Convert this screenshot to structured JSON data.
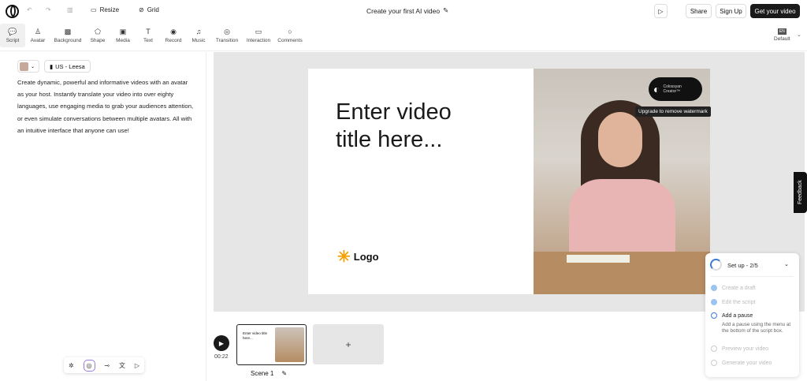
{
  "header": {
    "title": "Create your first AI video",
    "resize": "Resize",
    "grid": "Grid",
    "share": "Share",
    "signup": "Sign Up",
    "get_video": "Get your video"
  },
  "tools": [
    {
      "label": "Script",
      "icon": "💬"
    },
    {
      "label": "Avatar",
      "icon": "♙"
    },
    {
      "label": "Background",
      "icon": "▩"
    },
    {
      "label": "Shape",
      "icon": "⬠"
    },
    {
      "label": "Media",
      "icon": "▣"
    },
    {
      "label": "Text",
      "icon": "T"
    },
    {
      "label": "Record",
      "icon": "◉"
    },
    {
      "label": "Music",
      "icon": "♫"
    },
    {
      "label": "Transition",
      "icon": "◎"
    },
    {
      "label": "Interaction",
      "icon": "▭"
    },
    {
      "label": "Comments",
      "icon": "○"
    }
  ],
  "language": {
    "code": "EN",
    "label": "Default"
  },
  "script": {
    "voice": "US - Leesa",
    "text": "Create dynamic, powerful and informative videos with an avatar as your host. Instantly translate your video into over eighty languages, use engaging media to grab your audiences attention, or even simulate conversations between multiple avatars. All with an intuitive interface that anyone can use!"
  },
  "slide": {
    "title": "Enter video title here...",
    "logo": "Logo",
    "watermark": "Colossyan Creator™",
    "watermark_tip": "Upgrade to remove watermark"
  },
  "feedback": "Feedback",
  "timeline": {
    "duration": "00:22",
    "scene": "Scene 1",
    "thumb_title": "Enter video title here...",
    "add": "+"
  },
  "setup": {
    "title": "Set up - 2/5",
    "progress": 0.4,
    "steps": [
      {
        "label": "Create a draft",
        "state": "done"
      },
      {
        "label": "Edit the script",
        "state": "done"
      },
      {
        "label": "Add a pause",
        "state": "active",
        "desc": "Add a pause using the menu at the bottom of the script box."
      },
      {
        "label": "Preview your video",
        "state": "todo"
      },
      {
        "label": "Generate your video",
        "state": "todo"
      }
    ]
  }
}
